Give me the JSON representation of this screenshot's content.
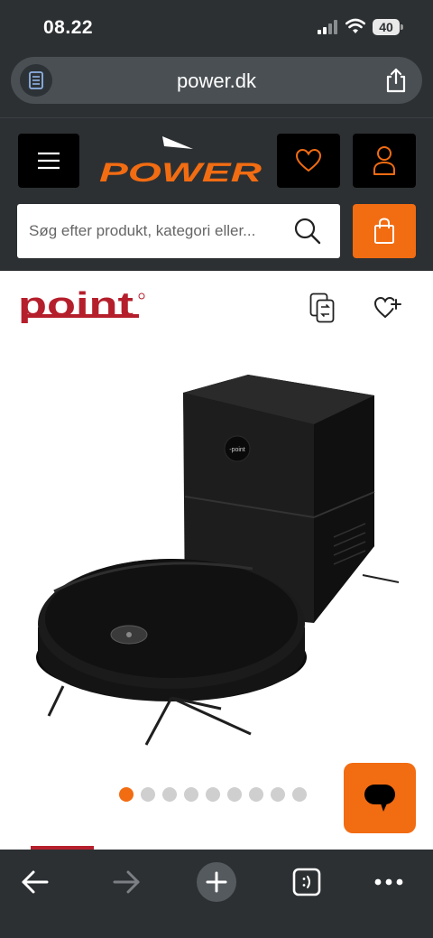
{
  "status_bar": {
    "time": "08.22",
    "battery": "40"
  },
  "browser": {
    "url": "power.dk"
  },
  "header": {
    "logo_text": "POWER",
    "search": {
      "placeholder": "Søg efter produkt, kategori eller..."
    }
  },
  "product": {
    "brand": "point",
    "image_dots": {
      "count": 9,
      "active_index": 0
    }
  },
  "colors": {
    "accent": "#f26c12",
    "header_bg": "#2c3033",
    "brand_red": "#b51f2c"
  },
  "icons": {
    "status": [
      "signal-icon",
      "wifi-icon",
      "battery-icon"
    ],
    "header": [
      "menu-icon",
      "heart-icon",
      "user-icon",
      "search-icon",
      "shopping-bag-icon"
    ],
    "product": [
      "compare-icon",
      "heart-plus-icon"
    ],
    "toolbar": [
      "back-arrow-icon",
      "forward-arrow-icon",
      "plus-icon",
      "tabs-icon",
      "more-icon"
    ]
  }
}
